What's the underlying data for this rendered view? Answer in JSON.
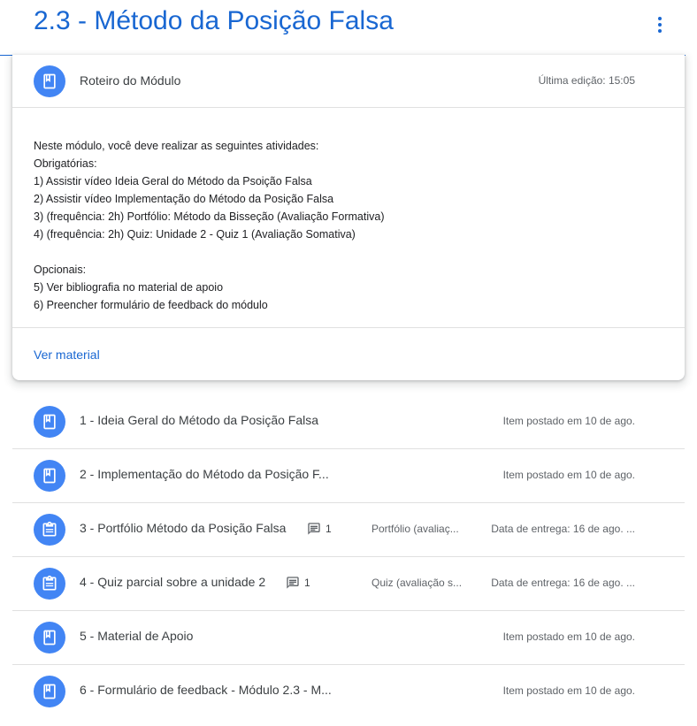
{
  "topic": {
    "title": "2.3 - Método da Posição Falsa"
  },
  "colors": {
    "accent": "#1967d2",
    "icon_bg": "#4285f4"
  },
  "material_card": {
    "icon": "book-icon",
    "title": "Roteiro do Módulo",
    "edited": "Última edição: 15:05",
    "body": [
      "Neste módulo, você deve realizar as seguintes atividades:",
      "Obrigatórias:",
      "1) Assistir vídeo Ideia Geral do Método da Psoição Falsa",
      "2) Assistir vídeo Implementação do Método da Posição Falsa",
      "3) (frequência: 2h) Portfólio: Método da Bisseção (Avaliação Formativa)",
      "4) (frequência: 2h) Quiz: Unidade 2 - Quiz 1 (Avaliação Somativa)",
      "",
      "Opcionais:",
      "5) Ver bibliografia no material de apoio",
      "6) Preencher formulário de feedback do módulo"
    ],
    "link": "Ver material"
  },
  "items": [
    {
      "icon": "book-icon",
      "title": "1 - Ideia Geral do Método da Posição Falsa",
      "meta": "Item postado em 10 de ago."
    },
    {
      "icon": "book-icon",
      "title": "2 - Implementação do Método da Posição F...",
      "meta": "Item postado em 10 de ago."
    },
    {
      "icon": "assignment-icon",
      "title": "3 - Portfólio Método da Posição Falsa",
      "comments": "1",
      "category": "Portfólio (avaliaç...",
      "meta": "Data de entrega: 16 de ago. ..."
    },
    {
      "icon": "assignment-icon",
      "title": "4 - Quiz parcial sobre a unidade 2",
      "comments": "1",
      "category": "Quiz (avaliação s...",
      "meta": "Data de entrega: 16 de ago. ..."
    },
    {
      "icon": "book-icon",
      "title": "5 - Material de Apoio",
      "meta": "Item postado em 10 de ago."
    },
    {
      "icon": "book-icon",
      "title": "6 - Formulário de feedback - Módulo 2.3 - M...",
      "meta": "Item postado em 10 de ago."
    }
  ]
}
